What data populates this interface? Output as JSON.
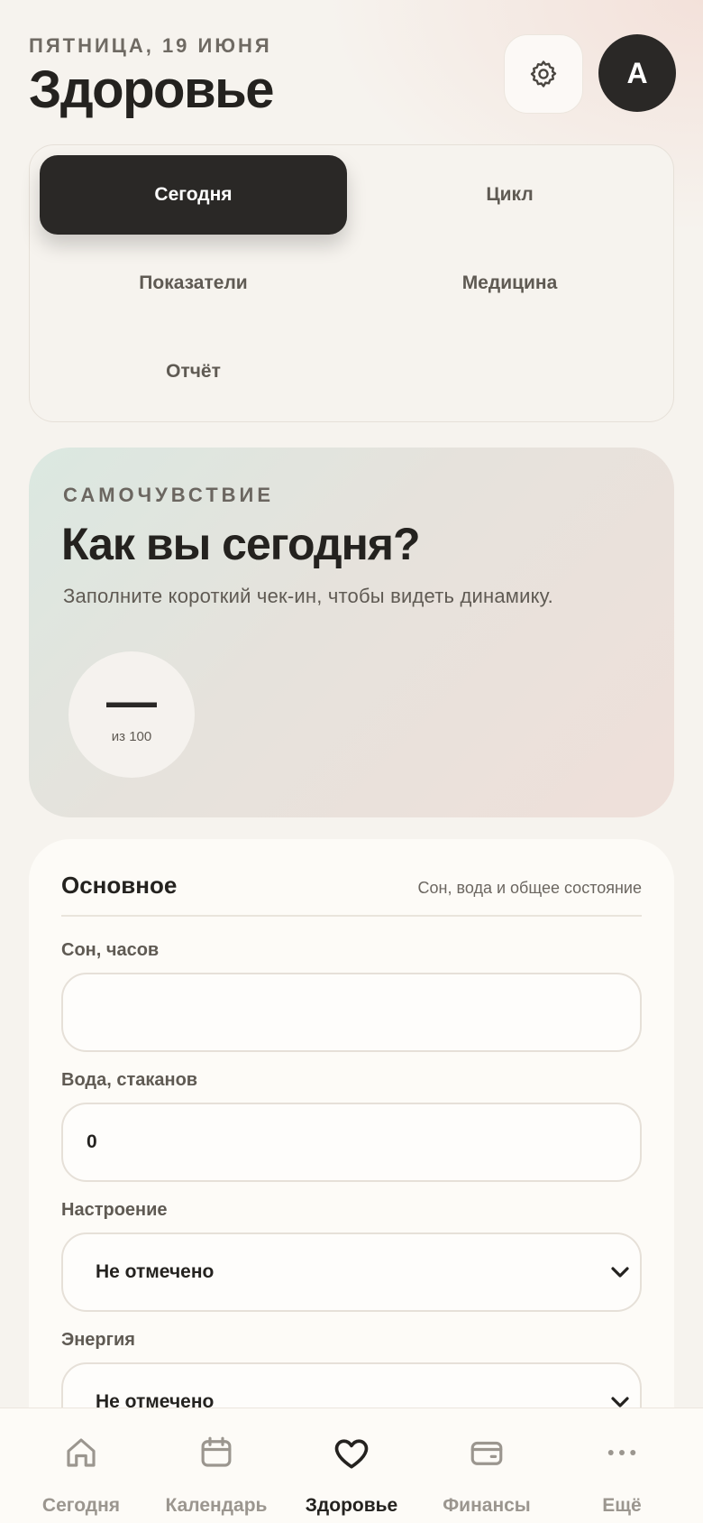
{
  "header": {
    "date": "ПЯТНИЦА, 19 ИЮНЯ",
    "title": "Здоровье",
    "avatar_letter": "А",
    "settings_icon": "gear-icon"
  },
  "tabs": [
    {
      "label": "Сегодня",
      "active": true
    },
    {
      "label": "Цикл",
      "active": false
    },
    {
      "label": "Показатели",
      "active": false
    },
    {
      "label": "Медицина",
      "active": false
    },
    {
      "label": "Отчёт",
      "active": false
    }
  ],
  "wellbeing": {
    "eyebrow": "САМОЧУВСТВИЕ",
    "question": "Как вы сегодня?",
    "hint": "Заполните короткий чек-ин, чтобы видеть динамику.",
    "score_value": "—",
    "score_of": "из 100"
  },
  "form": {
    "title": "Основное",
    "subtitle": "Сон, вода и общее состояние",
    "sleep_label": "Сон, часов",
    "sleep_value": "",
    "water_label": "Вода, стаканов",
    "water_value": "0",
    "mood_label": "Настроение",
    "mood_value": "Не отмечено",
    "energy_label": "Энергия",
    "energy_value": "Не отмечено"
  },
  "nav": [
    {
      "label": "Сегодня",
      "icon": "home-icon",
      "active": false
    },
    {
      "label": "Календарь",
      "icon": "calendar-icon",
      "active": false
    },
    {
      "label": "Здоровье",
      "icon": "heart-icon",
      "active": true
    },
    {
      "label": "Финансы",
      "icon": "wallet-icon",
      "active": false
    },
    {
      "label": "Ещё",
      "icon": "more-icon",
      "active": false
    }
  ],
  "colors": {
    "background": "#f6f3ee",
    "dark": "#2a2826",
    "muted": "#9b968f",
    "card": "#fdfbf7"
  }
}
